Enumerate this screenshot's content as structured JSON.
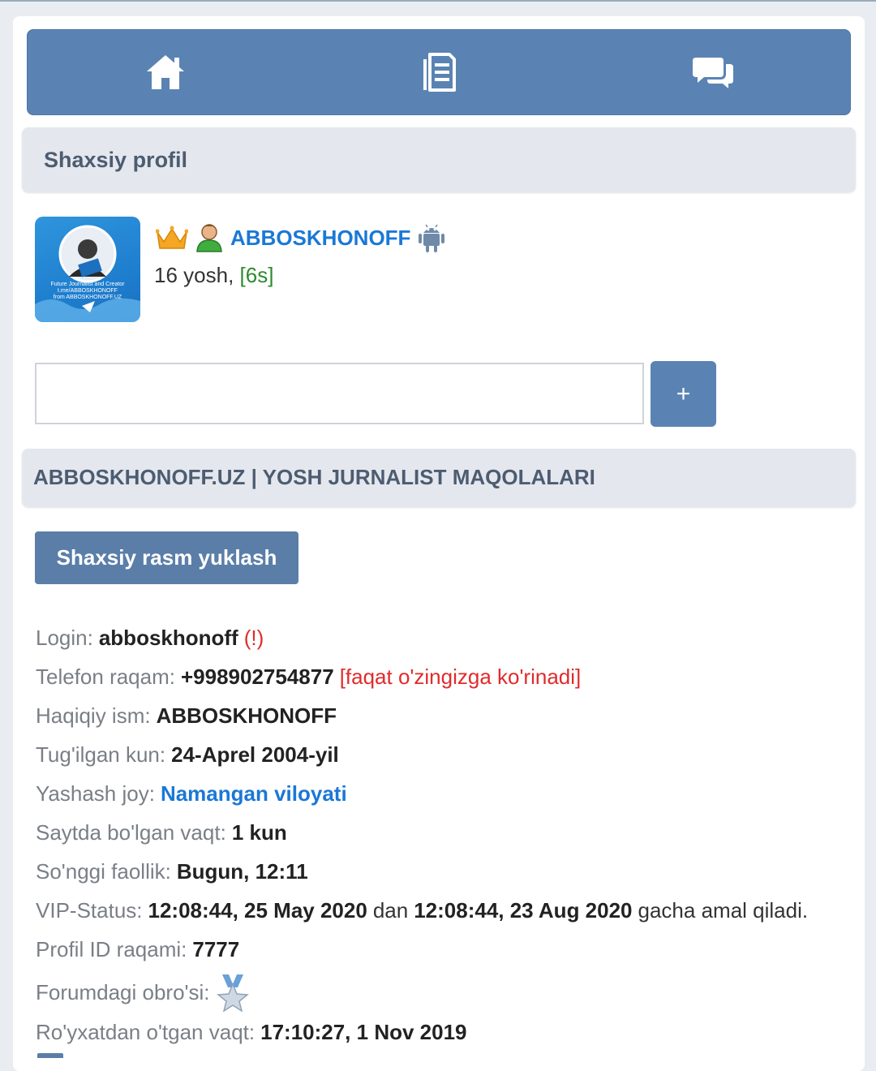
{
  "nav": {
    "home_icon": "home-icon",
    "docs_icon": "document-icon",
    "chat_icon": "chat-icon"
  },
  "profile_header": "Shaxsiy profil",
  "user": {
    "name": "ABBOSKHONOFF",
    "age": "16 yosh,",
    "tag": "[6s]",
    "badges": [
      "crown-icon",
      "user-icon",
      "android-icon"
    ],
    "avatar_lines": [
      "Future Journalist and Creator",
      "t.me/ABBOSKHONOFF",
      "from ABBOSKHONOFF.UZ"
    ]
  },
  "message": {
    "value": "",
    "add_label": "+"
  },
  "site_header": "ABBOSKHONOFF.UZ | YOSH JURNALIST MAQOLALARI",
  "upload_label": "Shaxsiy rasm yuklash",
  "info": {
    "login_label": "Login:",
    "login_value": "abboskhonoff",
    "login_warn": "(!)",
    "phone_label": "Telefon raqam:",
    "phone_value": "+998902754877",
    "phone_note": "[faqat o'zingizga ko'rinadi]",
    "realname_label": "Haqiqiy ism:",
    "realname_value": "ABBOSKHONOFF",
    "birthday_label": "Tug'ilgan kun:",
    "birthday_value": "24-Aprel 2004-yil",
    "location_label": "Yashash joy:",
    "location_value": "Namangan viloyati",
    "onsite_label": "Saytda bo'lgan vaqt:",
    "onsite_value": "1 kun",
    "lastactive_label": "So'nggi faollik:",
    "lastactive_value": "Bugun, 12:11",
    "vip_label": "VIP-Status:",
    "vip_from": "12:08:44, 25 May 2020",
    "vip_dan": "dan",
    "vip_to": "12:08:44, 23 Aug 2020",
    "vip_tail": "gacha amal qiladi.",
    "id_label": "Profil ID raqami:",
    "id_value": "7777",
    "rep_label": "Forumdagi obro'si:",
    "rep_icon": "star-medal-icon",
    "reg_label": "Ro'yxatdan o'tgan vaqt:",
    "reg_value": "17:10:27, 1 Nov 2019"
  },
  "colors": {
    "accent": "#5a83b3",
    "link": "#1a78d6",
    "warn": "#e02b2b",
    "green": "#2e8a2e"
  }
}
